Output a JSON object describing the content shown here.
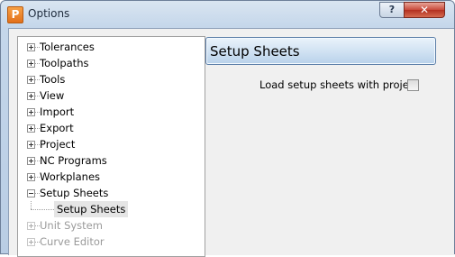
{
  "window": {
    "title": "Options",
    "app_icon_letter": "P",
    "help_label": "?",
    "close_label": "✕"
  },
  "tree": {
    "items": [
      {
        "label": "Tolerances",
        "expander": "plus",
        "disabled": false
      },
      {
        "label": "Toolpaths",
        "expander": "plus",
        "disabled": false
      },
      {
        "label": "Tools",
        "expander": "plus",
        "disabled": false
      },
      {
        "label": "View",
        "expander": "plus",
        "disabled": false
      },
      {
        "label": "Import",
        "expander": "plus",
        "disabled": false
      },
      {
        "label": "Export",
        "expander": "plus",
        "disabled": false
      },
      {
        "label": "Project",
        "expander": "plus",
        "disabled": false
      },
      {
        "label": "NC Programs",
        "expander": "plus",
        "disabled": false
      },
      {
        "label": "Workplanes",
        "expander": "plus",
        "disabled": false
      },
      {
        "label": "Setup Sheets",
        "expander": "minus",
        "disabled": false
      },
      {
        "label": "Unit System",
        "expander": "plus",
        "disabled": true
      },
      {
        "label": "Curve Editor",
        "expander": "plus",
        "disabled": true
      }
    ],
    "selected_child": "Setup Sheets"
  },
  "panel": {
    "title": "Setup Sheets",
    "option_label": "Load setup sheets with project",
    "option_checked": false
  }
}
